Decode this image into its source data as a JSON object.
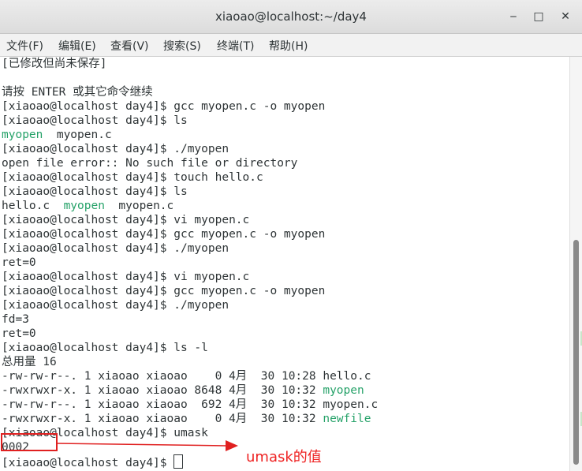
{
  "window": {
    "title": "xiaoao@localhost:~/day4",
    "controls": {
      "minimize": "‒",
      "maximize": "□",
      "close": "✕"
    }
  },
  "menu": {
    "items": [
      "文件(F)",
      "编辑(E)",
      "查看(V)",
      "搜索(S)",
      "终端(T)",
      "帮助(H)"
    ]
  },
  "terminal": {
    "lines": [
      "[已修改但尚未保存]",
      "",
      "请按 ENTER 或其它命令继续",
      "[xiaoao@localhost day4]$ gcc myopen.c -o myopen",
      "[xiaoao@localhost day4]$ ls",
      "",
      "[xiaoao@localhost day4]$ ./myopen",
      "open file error:: No such file or directory",
      "[xiaoao@localhost day4]$ touch hello.c",
      "[xiaoao@localhost day4]$ ls",
      "",
      "[xiaoao@localhost day4]$ vi myopen.c",
      "[xiaoao@localhost day4]$ gcc myopen.c -o myopen",
      "[xiaoao@localhost day4]$ ./myopen",
      "ret=0",
      "[xiaoao@localhost day4]$ vi myopen.c",
      "[xiaoao@localhost day4]$ gcc myopen.c -o myopen",
      "[xiaoao@localhost day4]$ ./myopen",
      "fd=3",
      "ret=0",
      "[xiaoao@localhost day4]$ ls -l",
      "总用量 16",
      "-rw-rw-r--. 1 xiaoao xiaoao    0 4月  30 10:28 hello.c",
      "-rwxrwxr-x. 1 xiaoao xiaoao 8648 4月  30 10:32 ",
      "-rw-rw-r--. 1 xiaoao xiaoao  692 4月  30 10:32 myopen.c",
      "-rwxrwxr-x. 1 xiaoao xiaoao    0 4月  30 10:32 ",
      "[xiaoao@localhost day4]$ umask",
      "0002",
      "[xiaoao@localhost day4]$ "
    ],
    "ls1": {
      "exe": "myopen",
      "rest": "  myopen.c"
    },
    "ls2": {
      "pre": "hello.c  ",
      "exe": "myopen",
      "rest": "  myopen.c"
    },
    "ll_exe_1": "myopen",
    "ll_exe_2": "newfile"
  },
  "annotation": {
    "text": "umask的值",
    "color": "#ee2222"
  },
  "colors": {
    "executable": "#26a269",
    "text": "#2e3436",
    "highlight_box": "#e02020"
  }
}
